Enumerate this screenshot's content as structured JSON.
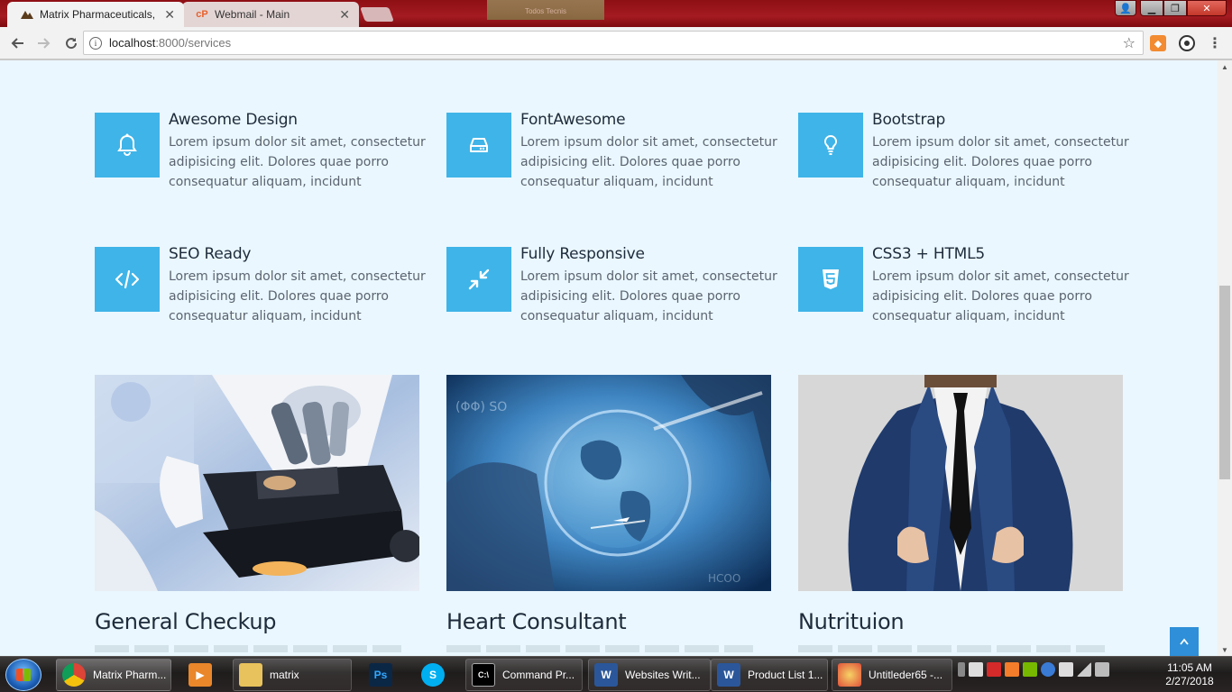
{
  "browser": {
    "tabs": [
      {
        "title": "Matrix Pharmaceuticals, I",
        "active": true,
        "icon": "matrix-logo-icon"
      },
      {
        "title": "Webmail - Main",
        "active": false,
        "icon": "cpanel-icon"
      }
    ],
    "background_tab_hint": "Todos Tecnis",
    "address": {
      "host": "localhost",
      "path": ":8000/services"
    }
  },
  "features": [
    {
      "title": "Awesome Design",
      "text": "Lorem ipsum dolor sit amet, consectetur adipisicing elit. Dolores quae porro consequatur aliquam, incidunt",
      "icon": "bell-icon"
    },
    {
      "title": "FontAwesome",
      "text": "Lorem ipsum dolor sit amet, consectetur adipisicing elit. Dolores quae porro consequatur aliquam, incidunt",
      "icon": "hdd-icon"
    },
    {
      "title": "Bootstrap",
      "text": "Lorem ipsum dolor sit amet, consectetur adipisicing elit. Dolores quae porro consequatur aliquam, incidunt",
      "icon": "lightbulb-icon"
    },
    {
      "title": "SEO Ready",
      "text": "Lorem ipsum dolor sit amet, consectetur adipisicing elit. Dolores quae porro consequatur aliquam, incidunt",
      "icon": "code-icon"
    },
    {
      "title": "Fully Responsive",
      "text": "Lorem ipsum dolor sit amet, consectetur adipisicing elit. Dolores quae porro consequatur aliquam, incidunt",
      "icon": "compress-icon"
    },
    {
      "title": "CSS3 + HTML5",
      "text": "Lorem ipsum dolor sit amet, consectetur adipisicing elit. Dolores quae porro consequatur aliquam, incidunt",
      "icon": "html5-icon"
    }
  ],
  "services": [
    {
      "title": "General Checkup"
    },
    {
      "title": "Heart Consultant"
    },
    {
      "title": "Nutrituion"
    }
  ],
  "colors": {
    "accent": "#3fb4e8",
    "page_bg": "#eaf7fe",
    "heading": "#1e2b3a",
    "body_text": "#5b6470"
  },
  "taskbar": {
    "items": [
      {
        "label": "Matrix Pharm...",
        "icon": "chrome-icon"
      },
      {
        "label": "",
        "icon": "media-player-icon"
      },
      {
        "label": "matrix",
        "icon": "folder-icon"
      },
      {
        "label": "",
        "icon": "photoshop-icon"
      },
      {
        "label": "",
        "icon": "skype-icon"
      },
      {
        "label": "Command Pr...",
        "icon": "cmd-icon"
      },
      {
        "label": "Websites Writ...",
        "icon": "word-icon"
      },
      {
        "label": "Product List 1...",
        "icon": "word-icon"
      },
      {
        "label": "Untitleder65 -...",
        "icon": "paint-icon"
      }
    ],
    "clock": {
      "time": "11:05 AM",
      "date": "2/27/2018"
    }
  }
}
